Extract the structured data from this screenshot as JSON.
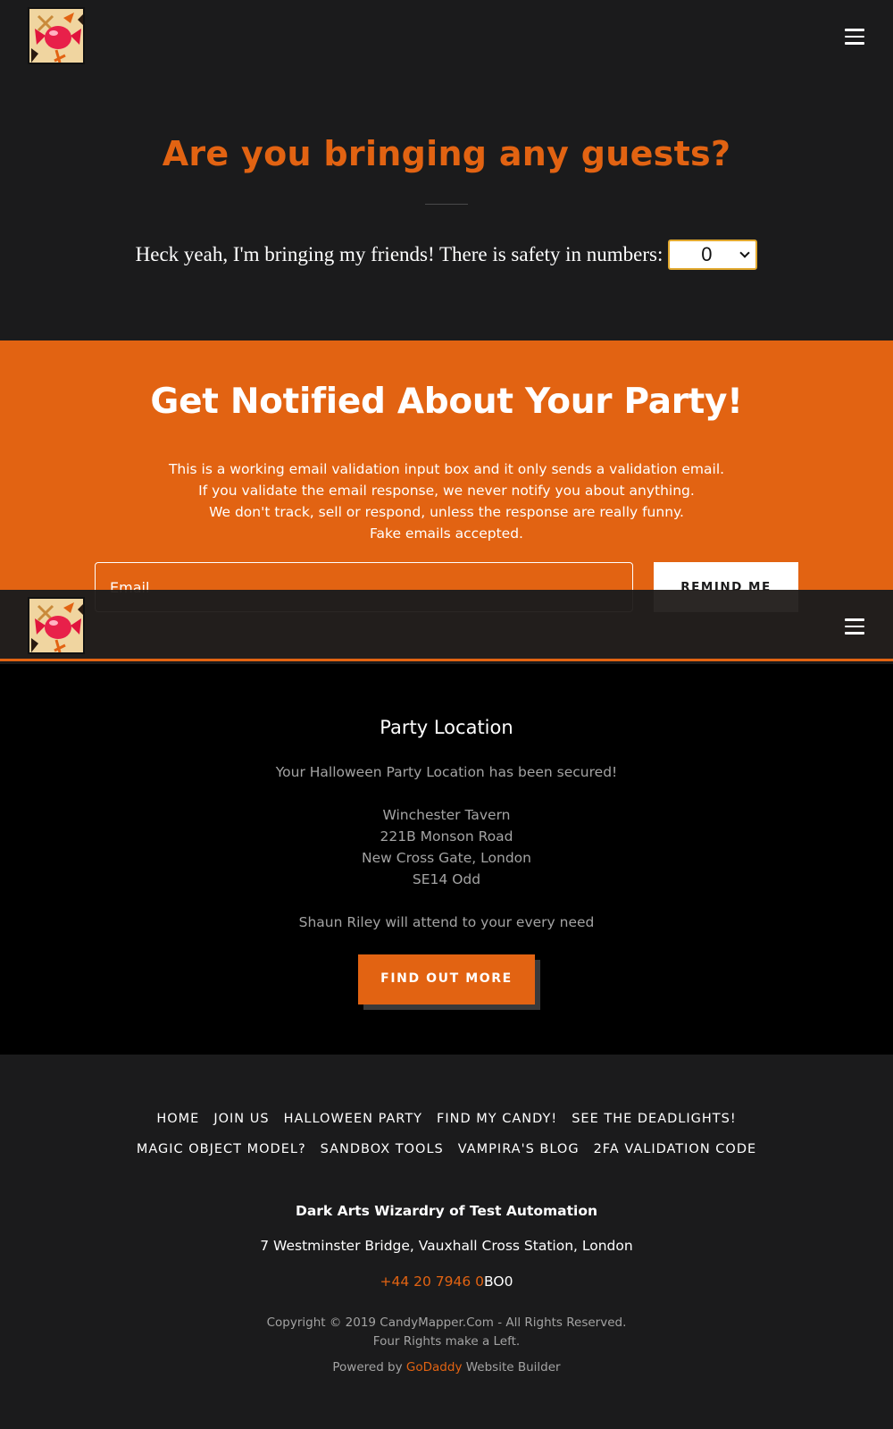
{
  "header": {
    "logo_alt": "candy-mapper-logo",
    "menu_icon": "hamburger-menu-icon"
  },
  "guests": {
    "title": "Are you bringing any guests?",
    "label": "Heck yeah, I'm bringing my friends! There is safety in numbers:",
    "selected_value": "0"
  },
  "notify": {
    "title": "Get Notified About Your Party!",
    "description": [
      "This is a working email validation input box and it only sends a validation email.",
      "If you validate the email response, we never notify you about anything.",
      "We don't track, sell or respond, unless the response are really funny.",
      "Fake emails accepted."
    ],
    "email_placeholder": "Email",
    "button_label": "REMIND ME"
  },
  "location": {
    "title": "Party Location",
    "secured_text": "Your Halloween Party Location has been secured!",
    "address_lines": [
      "Winchester Tavern",
      "221B Monson Road",
      "New Cross Gate, London",
      "SE14 Odd"
    ],
    "host_text": "Shaun Riley will attend to your every need",
    "button_label": "FIND OUT MORE"
  },
  "footer": {
    "nav_row1": [
      "HOME",
      "JOIN US",
      "HALLOWEEN PARTY",
      "FIND MY CANDY!",
      "SEE THE DEADLIGHTS!"
    ],
    "nav_row2": [
      "MAGIC OBJECT MODEL?",
      "SANDBOX TOOLS",
      "VAMPIRA'S BLOG",
      "2FA VALIDATION CODE"
    ],
    "company": "Dark Arts Wizardry of Test Automation",
    "address": "7 Westminster Bridge, Vauxhall Cross Station, London",
    "phone_orange": "+44 20 7946 0",
    "phone_white": "BO0",
    "copyright": "Copyright © 2019 CandyMapper.Com - All Rights Reserved.",
    "tagline": "Four Rights make a Left.",
    "powered_prefix": "Powered by",
    "powered_link": "GoDaddy",
    "powered_suffix": "Website Builder"
  },
  "colors": {
    "accent": "#e26312",
    "dark_bg": "#1b1b1c",
    "black_bg": "#000000",
    "select_border": "#e2a92f"
  }
}
